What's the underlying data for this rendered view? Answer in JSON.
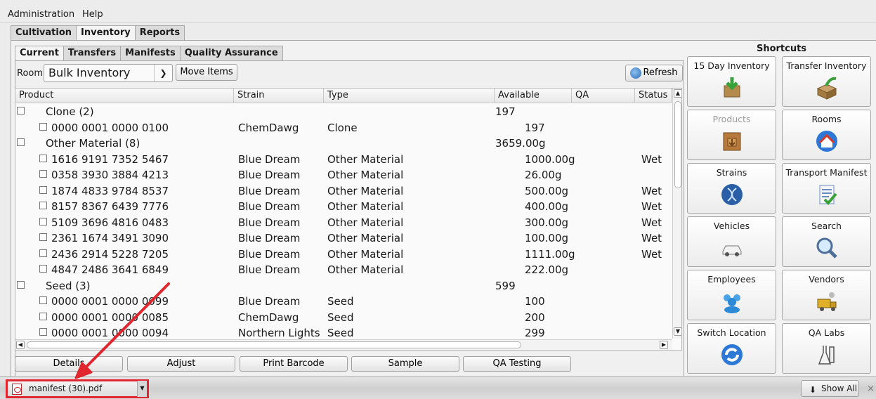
{
  "menu": [
    "Administration",
    "Help"
  ],
  "main_tabs": [
    "Cultivation",
    "Inventory",
    "Reports"
  ],
  "sub_tabs": [
    "Current",
    "Transfers",
    "Manifests",
    "Quality Assurance"
  ],
  "toolbar": {
    "room_label": "Room",
    "room_value": "Bulk Inventory",
    "move_items": "Move Items",
    "refresh": "Refresh"
  },
  "grid": {
    "columns": [
      "Product",
      "Strain",
      "Type",
      "Available",
      "QA",
      "Status"
    ],
    "rows": [
      {
        "group": true,
        "product": "Clone (2)",
        "available": "197"
      },
      {
        "product": "0000 0001 0000 0100",
        "strain": "ChemDawg",
        "type": "Clone",
        "available": "197",
        "status": ""
      },
      {
        "group": true,
        "product": "Other Material (8)",
        "available": "3659.00g"
      },
      {
        "product": "1616 9191 7352 5467",
        "strain": "Blue Dream",
        "type": "Other Material",
        "available": "1000.00g",
        "status": "Wet"
      },
      {
        "product": "0358 3930 3884 4213",
        "strain": "Blue Dream",
        "type": "Other Material",
        "available": "26.00g",
        "status": ""
      },
      {
        "product": "1874 4833 9784 8537",
        "strain": "Blue Dream",
        "type": "Other Material",
        "available": "500.00g",
        "status": "Wet"
      },
      {
        "product": "8157 8367 6439 7776",
        "strain": "Blue Dream",
        "type": "Other Material",
        "available": "400.00g",
        "status": "Wet"
      },
      {
        "product": "5109 3696 4816 0483",
        "strain": "Blue Dream",
        "type": "Other Material",
        "available": "300.00g",
        "status": "Wet"
      },
      {
        "product": "2361 1674 3491 3090",
        "strain": "Blue Dream",
        "type": "Other Material",
        "available": "100.00g",
        "status": "Wet"
      },
      {
        "product": "2436 2914 5228 7205",
        "strain": "Blue Dream",
        "type": "Other Material",
        "available": "1111.00g",
        "status": "Wet"
      },
      {
        "product": "4847 2486 3641 6849",
        "strain": "Blue Dream",
        "type": "Other Material",
        "available": "222.00g",
        "status": ""
      },
      {
        "group": true,
        "product": "Seed (3)",
        "available": "599"
      },
      {
        "product": "0000 0001 0000 0099",
        "strain": "Blue Dream",
        "type": "Seed",
        "available": "100",
        "status": ""
      },
      {
        "product": "0000 0001 0000 0085",
        "strain": "ChemDawg",
        "type": "Seed",
        "available": "200",
        "status": ""
      },
      {
        "product": "0000 0001 0000 0094",
        "strain": "Northern Lights",
        "type": "Seed",
        "available": "299",
        "status": ""
      }
    ]
  },
  "bottom_buttons": [
    "Details",
    "Adjust",
    "Print Barcode",
    "Sample",
    "QA Testing"
  ],
  "shortcuts": {
    "title": "Shortcuts",
    "items": [
      {
        "label": "15 Day Inventory",
        "icon": "download-box-icon",
        "enabled": true
      },
      {
        "label": "Transfer Inventory",
        "icon": "transfer-box-icon",
        "enabled": true
      },
      {
        "label": "Products",
        "icon": "product-crate-icon",
        "enabled": false
      },
      {
        "label": "Rooms",
        "icon": "house-icon",
        "enabled": true
      },
      {
        "label": "Strains",
        "icon": "dna-icon",
        "enabled": true
      },
      {
        "label": "Transport Manifest",
        "icon": "checklist-icon",
        "enabled": true
      },
      {
        "label": "Vehicles",
        "icon": "car-icon",
        "enabled": true
      },
      {
        "label": "Search",
        "icon": "magnifier-icon",
        "enabled": true
      },
      {
        "label": "Employees",
        "icon": "people-icon",
        "enabled": true
      },
      {
        "label": "Vendors",
        "icon": "vendor-truck-icon",
        "enabled": true
      },
      {
        "label": "Switch Location",
        "icon": "refresh-arrows-icon",
        "enabled": true
      },
      {
        "label": "QA Labs",
        "icon": "lab-flask-icon",
        "enabled": true
      }
    ]
  },
  "downloads": {
    "file_name": "manifest (30).pdf",
    "show_all": "Show All",
    "close": "×"
  },
  "colors": {
    "highlight": "#e0262e",
    "accent_blue": "#2a6cb8"
  }
}
